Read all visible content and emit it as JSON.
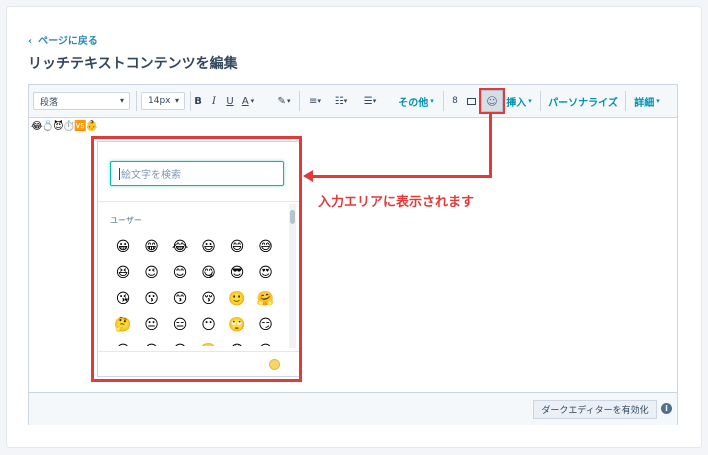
{
  "nav": {
    "back_label": "ページに戻る"
  },
  "page": {
    "title": "リッチテキストコンテンツを編集"
  },
  "toolbar": {
    "paragraph_style": "段落",
    "font_size": "14px",
    "bold": "B",
    "italic": "I",
    "underline": "U",
    "text_color": "A",
    "other_label": "その他",
    "insert_label": "挿入",
    "personalize_label": "パーソナライズ",
    "details_label": "詳細"
  },
  "content": {
    "inserted_emojis": "😂💍😈⏱️🆚👶"
  },
  "emoji_picker": {
    "search_placeholder": "絵文字を検索",
    "section_label": "ユーザー",
    "emojis": [
      "😀",
      "😁",
      "😂",
      "😃",
      "😄",
      "😅",
      "😆",
      "😉",
      "😊",
      "😋",
      "😎",
      "😍",
      "😘",
      "😗",
      "😙",
      "😚",
      "🙂",
      "🤗",
      "🤔",
      "😐",
      "😑",
      "😶",
      "🙄",
      "😏",
      "😣",
      "😥",
      "😮",
      "🤐",
      "😯",
      "😪"
    ]
  },
  "footer": {
    "dark_editor_label": "ダークエディターを有効化",
    "info_icon": "i"
  },
  "annotation": {
    "text": "入力エリアに表示されます",
    "color": "#e03a3a"
  },
  "colors": {
    "accent": "#0091ae",
    "highlight": "#e03a3a",
    "focus": "#00bda5"
  }
}
